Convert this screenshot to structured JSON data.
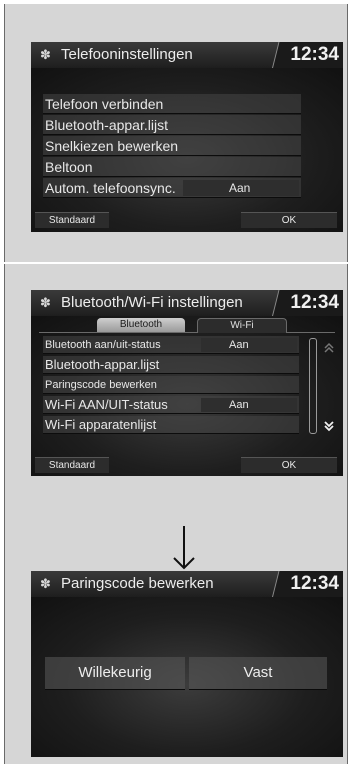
{
  "screen1": {
    "title": "Telefooninstellingen",
    "clock": "12:34",
    "items": [
      {
        "label": "Telefoon verbinden",
        "value": ""
      },
      {
        "label": "Bluetooth-appar.lijst",
        "value": ""
      },
      {
        "label": "Snelkiezen bewerken",
        "value": ""
      },
      {
        "label": "Beltoon",
        "value": ""
      },
      {
        "label": "Autom. telefoonsync.",
        "value": "Aan"
      }
    ],
    "left_button": "Standaard",
    "right_button": "OK"
  },
  "screen2": {
    "title": "Bluetooth/Wi-Fi instellingen",
    "clock": "12:34",
    "tabs": [
      {
        "label": "Bluetooth",
        "active": true
      },
      {
        "label": "Wi-Fi",
        "active": false
      }
    ],
    "items": [
      {
        "label": "Bluetooth aan/uit-status",
        "value": "Aan"
      },
      {
        "label": "Bluetooth-appar.lijst",
        "value": ""
      },
      {
        "label": "Paringscode bewerken",
        "value": ""
      },
      {
        "label": "Wi-Fi AAN/UIT-status",
        "value": "Aan"
      },
      {
        "label": "Wi-Fi apparatenlijst",
        "value": ""
      }
    ],
    "left_button": "Standaard",
    "right_button": "OK"
  },
  "screen3": {
    "title": "Paringscode bewerken",
    "clock": "12:34",
    "options": [
      "Willekeurig",
      "Vast"
    ]
  }
}
